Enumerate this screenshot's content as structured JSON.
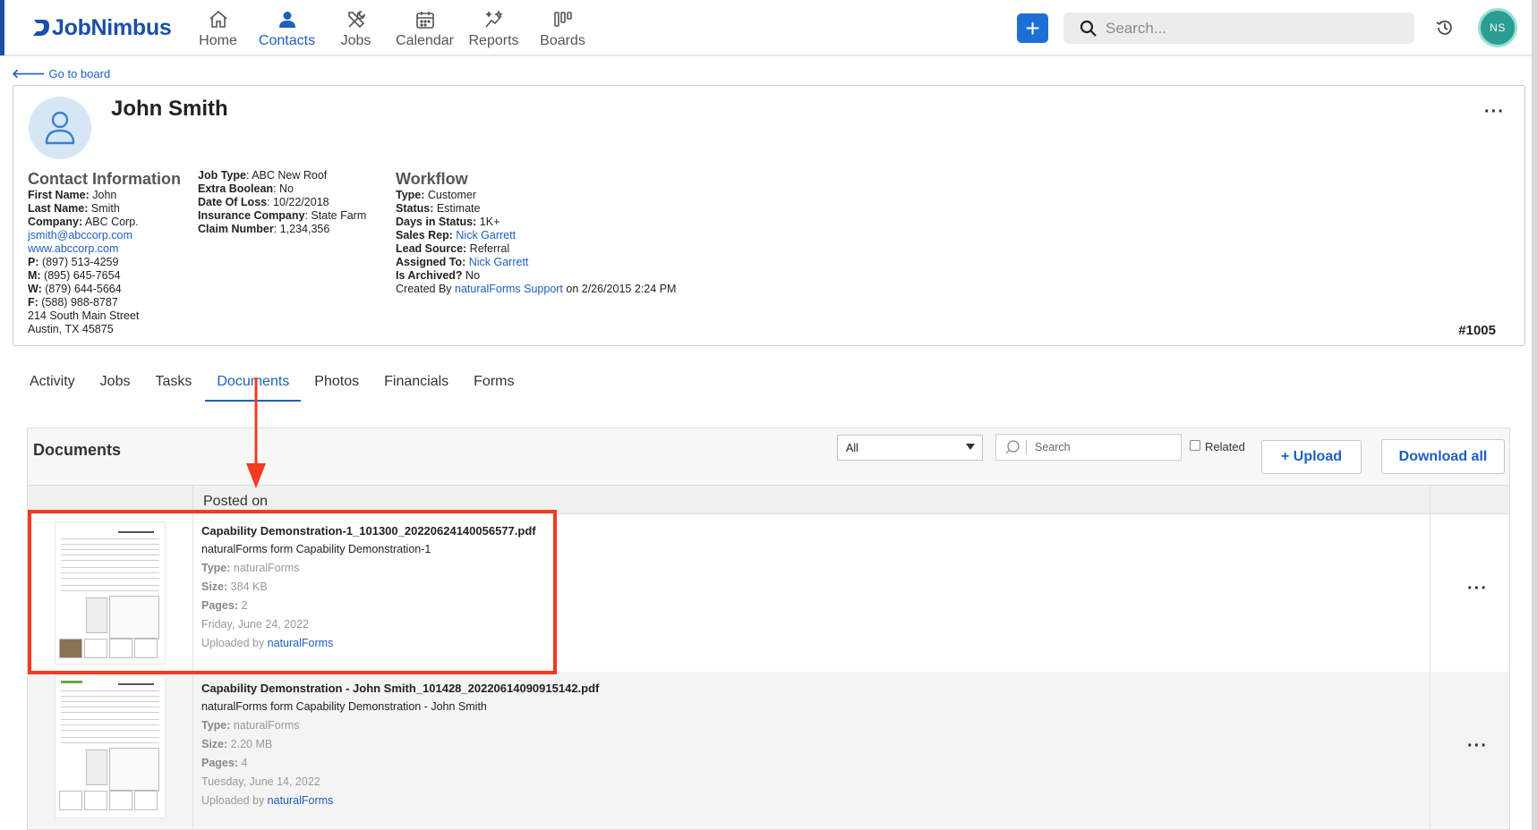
{
  "app": {
    "logo_text": "JobNimbus",
    "nav": [
      {
        "label": "Home",
        "icon": "home-icon",
        "active": false
      },
      {
        "label": "Contacts",
        "icon": "person-icon",
        "active": true
      },
      {
        "label": "Jobs",
        "icon": "tools-icon",
        "active": false
      },
      {
        "label": "Calendar",
        "icon": "calendar-icon",
        "active": false
      },
      {
        "label": "Reports",
        "icon": "sparkle-chart-icon",
        "active": false
      },
      {
        "label": "Boards",
        "icon": "boards-icon",
        "active": false
      }
    ],
    "add_label": "+",
    "search_placeholder": "Search...",
    "user_initials": "NS",
    "accent_color": "#1d5fbf",
    "avatar_color": "#2a9d94"
  },
  "back_link": "Go to board",
  "contact": {
    "name": "John Smith",
    "more": "···",
    "number": "#1005",
    "info": {
      "heading": "Contact Information",
      "first_name_label": "First Name:",
      "first_name": " John",
      "last_name_label": "Last Name:",
      "last_name": " Smith",
      "company_label": "Company:",
      "company": " ABC Corp.",
      "email": "jsmith@abccorp.com",
      "website": "www.abccorp.com",
      "phone_p_label": "P:",
      "phone_p": " (897) 513-4259",
      "phone_m_label": "M:",
      "phone_m": " (895) 645-7654",
      "phone_w_label": "W:",
      "phone_w": " (879) 644-5664",
      "phone_f_label": "F:",
      "phone_f": " (588) 988-8787",
      "address1": "214 South Main Street",
      "address2": "Austin, TX 45875"
    },
    "fields": {
      "job_type_label": "Job Type",
      "job_type": ": ABC New Roof",
      "extra_boolean_label": "Extra Boolean",
      "extra_boolean": ": No",
      "date_of_loss_label": "Date Of Loss",
      "date_of_loss": ": 10/22/2018",
      "insurance_label": "Insurance Company",
      "insurance": ": State Farm",
      "claim_label": "Claim Number",
      "claim": ": 1,234,356"
    },
    "workflow": {
      "heading": "Workflow",
      "type_label": "Type:",
      "type": " Customer",
      "status_label": "Status:",
      "status": " Estimate",
      "days_label": "Days in Status:",
      "days": " 1K+",
      "sales_rep_label": "Sales Rep:",
      "sales_rep": "Nick Garrett",
      "lead_source_label": "Lead Source:",
      "lead_source": " Referral",
      "assigned_label": "Assigned To:",
      "assigned": "Nick Garrett",
      "archived_label": "Is Archived?",
      "archived": " No",
      "created_prefix": "Created By ",
      "created_by": "naturalForms Support",
      "created_suffix": " on 2/26/2015 2:24 PM"
    }
  },
  "tabs": [
    "Activity",
    "Jobs",
    "Tasks",
    "Documents",
    "Photos",
    "Financials",
    "Forms"
  ],
  "active_tab": "Documents",
  "documents": {
    "title": "Documents",
    "filter_value": "All",
    "search_placeholder": "Search",
    "related_label": "Related",
    "upload_label": "+ Upload",
    "download_label": "Download all",
    "column_posted": "Posted on",
    "rows": [
      {
        "filename": "Capability Demonstration-1_101300_20220624140056577.pdf",
        "description": "naturalForms form Capability Demonstration-1",
        "type_label": "Type:",
        "type": " naturalForms",
        "size_label": "Size:",
        "size": " 384 KB",
        "pages_label": "Pages:",
        "pages": " 2",
        "date": "Friday, June 24, 2022",
        "uploaded_prefix": "Uploaded by ",
        "uploaded_by": "naturalForms",
        "more": "···"
      },
      {
        "filename": "Capability Demonstration - John Smith_101428_20220614090915142.pdf",
        "description": "naturalForms form Capability Demonstration - John Smith",
        "type_label": "Type:",
        "type": " naturalForms",
        "size_label": "Size:",
        "size": " 2.20 MB",
        "pages_label": "Pages:",
        "pages": " 4",
        "date": "Tuesday, June 14, 2022",
        "uploaded_prefix": "Uploaded by ",
        "uploaded_by": "naturalForms",
        "more": "···"
      }
    ]
  },
  "annotation_color": "#f23b1f"
}
